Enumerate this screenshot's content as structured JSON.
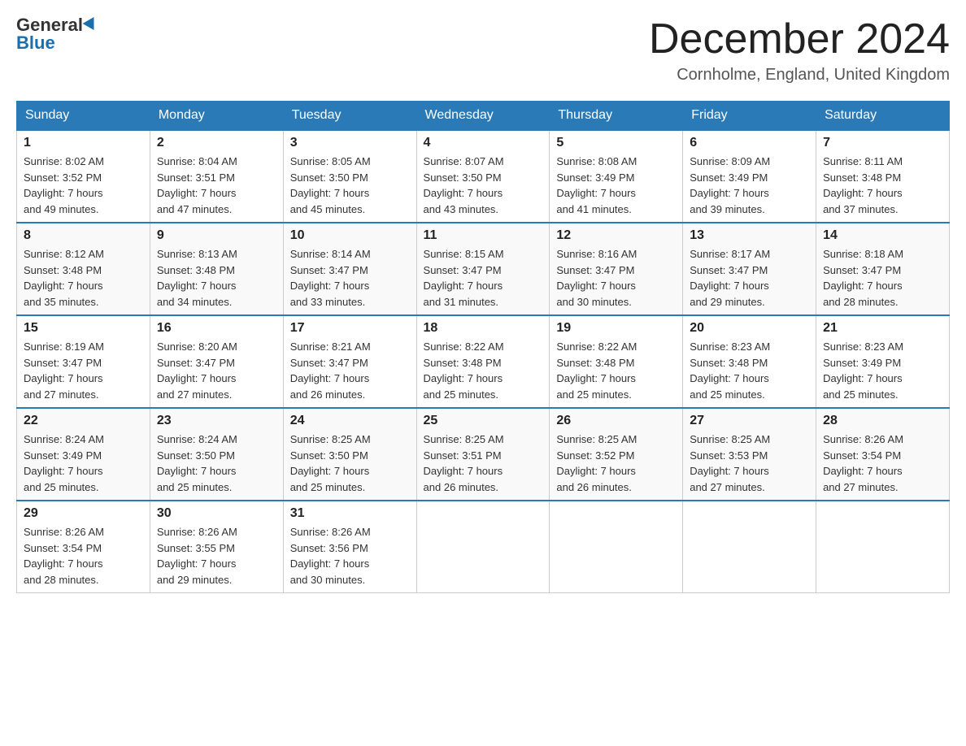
{
  "logo": {
    "general": "General",
    "blue": "Blue"
  },
  "header": {
    "title": "December 2024",
    "location": "Cornholme, England, United Kingdom"
  },
  "weekdays": [
    "Sunday",
    "Monday",
    "Tuesday",
    "Wednesday",
    "Thursday",
    "Friday",
    "Saturday"
  ],
  "weeks": [
    [
      {
        "day": "1",
        "sunrise": "8:02 AM",
        "sunset": "3:52 PM",
        "daylight": "7 hours and 49 minutes."
      },
      {
        "day": "2",
        "sunrise": "8:04 AM",
        "sunset": "3:51 PM",
        "daylight": "7 hours and 47 minutes."
      },
      {
        "day": "3",
        "sunrise": "8:05 AM",
        "sunset": "3:50 PM",
        "daylight": "7 hours and 45 minutes."
      },
      {
        "day": "4",
        "sunrise": "8:07 AM",
        "sunset": "3:50 PM",
        "daylight": "7 hours and 43 minutes."
      },
      {
        "day": "5",
        "sunrise": "8:08 AM",
        "sunset": "3:49 PM",
        "daylight": "7 hours and 41 minutes."
      },
      {
        "day": "6",
        "sunrise": "8:09 AM",
        "sunset": "3:49 PM",
        "daylight": "7 hours and 39 minutes."
      },
      {
        "day": "7",
        "sunrise": "8:11 AM",
        "sunset": "3:48 PM",
        "daylight": "7 hours and 37 minutes."
      }
    ],
    [
      {
        "day": "8",
        "sunrise": "8:12 AM",
        "sunset": "3:48 PM",
        "daylight": "7 hours and 35 minutes."
      },
      {
        "day": "9",
        "sunrise": "8:13 AM",
        "sunset": "3:48 PM",
        "daylight": "7 hours and 34 minutes."
      },
      {
        "day": "10",
        "sunrise": "8:14 AM",
        "sunset": "3:47 PM",
        "daylight": "7 hours and 33 minutes."
      },
      {
        "day": "11",
        "sunrise": "8:15 AM",
        "sunset": "3:47 PM",
        "daylight": "7 hours and 31 minutes."
      },
      {
        "day": "12",
        "sunrise": "8:16 AM",
        "sunset": "3:47 PM",
        "daylight": "7 hours and 30 minutes."
      },
      {
        "day": "13",
        "sunrise": "8:17 AM",
        "sunset": "3:47 PM",
        "daylight": "7 hours and 29 minutes."
      },
      {
        "day": "14",
        "sunrise": "8:18 AM",
        "sunset": "3:47 PM",
        "daylight": "7 hours and 28 minutes."
      }
    ],
    [
      {
        "day": "15",
        "sunrise": "8:19 AM",
        "sunset": "3:47 PM",
        "daylight": "7 hours and 27 minutes."
      },
      {
        "day": "16",
        "sunrise": "8:20 AM",
        "sunset": "3:47 PM",
        "daylight": "7 hours and 27 minutes."
      },
      {
        "day": "17",
        "sunrise": "8:21 AM",
        "sunset": "3:47 PM",
        "daylight": "7 hours and 26 minutes."
      },
      {
        "day": "18",
        "sunrise": "8:22 AM",
        "sunset": "3:48 PM",
        "daylight": "7 hours and 25 minutes."
      },
      {
        "day": "19",
        "sunrise": "8:22 AM",
        "sunset": "3:48 PM",
        "daylight": "7 hours and 25 minutes."
      },
      {
        "day": "20",
        "sunrise": "8:23 AM",
        "sunset": "3:48 PM",
        "daylight": "7 hours and 25 minutes."
      },
      {
        "day": "21",
        "sunrise": "8:23 AM",
        "sunset": "3:49 PM",
        "daylight": "7 hours and 25 minutes."
      }
    ],
    [
      {
        "day": "22",
        "sunrise": "8:24 AM",
        "sunset": "3:49 PM",
        "daylight": "7 hours and 25 minutes."
      },
      {
        "day": "23",
        "sunrise": "8:24 AM",
        "sunset": "3:50 PM",
        "daylight": "7 hours and 25 minutes."
      },
      {
        "day": "24",
        "sunrise": "8:25 AM",
        "sunset": "3:50 PM",
        "daylight": "7 hours and 25 minutes."
      },
      {
        "day": "25",
        "sunrise": "8:25 AM",
        "sunset": "3:51 PM",
        "daylight": "7 hours and 26 minutes."
      },
      {
        "day": "26",
        "sunrise": "8:25 AM",
        "sunset": "3:52 PM",
        "daylight": "7 hours and 26 minutes."
      },
      {
        "day": "27",
        "sunrise": "8:25 AM",
        "sunset": "3:53 PM",
        "daylight": "7 hours and 27 minutes."
      },
      {
        "day": "28",
        "sunrise": "8:26 AM",
        "sunset": "3:54 PM",
        "daylight": "7 hours and 27 minutes."
      }
    ],
    [
      {
        "day": "29",
        "sunrise": "8:26 AM",
        "sunset": "3:54 PM",
        "daylight": "7 hours and 28 minutes."
      },
      {
        "day": "30",
        "sunrise": "8:26 AM",
        "sunset": "3:55 PM",
        "daylight": "7 hours and 29 minutes."
      },
      {
        "day": "31",
        "sunrise": "8:26 AM",
        "sunset": "3:56 PM",
        "daylight": "7 hours and 30 minutes."
      },
      null,
      null,
      null,
      null
    ]
  ],
  "labels": {
    "sunrise": "Sunrise:",
    "sunset": "Sunset:",
    "daylight": "Daylight:"
  }
}
